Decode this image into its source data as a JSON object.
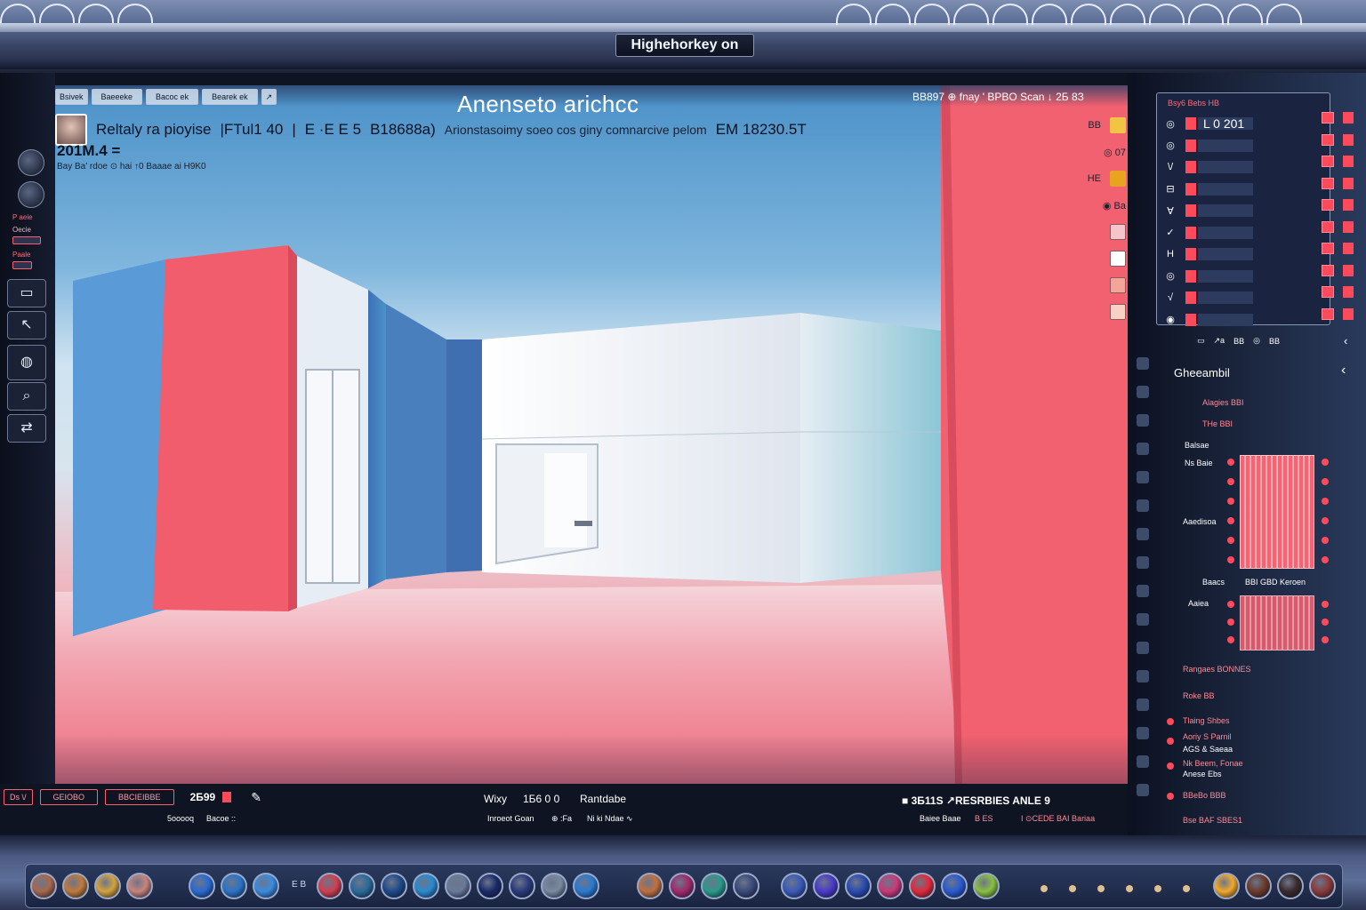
{
  "window": {
    "title": "Highehorkey on"
  },
  "top_tabs": [
    {
      "label": "Bsivek"
    },
    {
      "label": "Baeeeke"
    },
    {
      "label": "Bacoc ek"
    },
    {
      "label": "Bearek ek"
    },
    {
      "label": "↗"
    }
  ],
  "viewport": {
    "title": "Anensetо arichcc",
    "status_right": "BB897 ⊕ fnay ' BPBO Scan ↓ 2Б 8З",
    "info": {
      "project_name": "Reltaly ra pioyise",
      "frame": "|FTul1 40",
      "separator": "|",
      "codes": "E ·E E 5",
      "id": "B18688a)",
      "subtitle": "Arionstasoimy soeo cos giny comnarcive pelom",
      "coord": "EM 18230.5T"
    },
    "counter": "201M.4 =",
    "info_small": "Bay Ba' rdoe ⊙ hai ↑0 Baaae ai H9K0",
    "right_icons": [
      {
        "label": "BB",
        "color": "#f2c443"
      },
      {
        "label": "◎ 07",
        "color": ""
      },
      {
        "label": "HE",
        "color": "#e8a320"
      },
      {
        "label": "◉ Ba",
        "color": ""
      },
      {
        "label": "",
        "color": "#f4c6cb"
      },
      {
        "label": "",
        "color": "#ffffff"
      },
      {
        "label": "",
        "color": "#f3a59a"
      },
      {
        "label": "",
        "color": "#f8d1c4"
      }
    ],
    "bottom_left": {
      "mode_label": "Ds \\/",
      "box_a": "GEIOBO",
      "box_b": "BBCIEIBBE",
      "number": "2Б99",
      "sub_a": "5ooooq",
      "sub_b": "Bacoe ::"
    },
    "bottom_center": {
      "label": "Wixy",
      "value": "1Б6 0 0",
      "name": "Rantdabe",
      "sub_a": "Inroeot Goan",
      "sub_b": "⊕ :Fa",
      "sub_c": "Ni ki Ndae ∿"
    },
    "bottom_right": {
      "status": "■ 3Б11S ↗RESRBIES ANLE 9",
      "sub_a": "Baiee Baae",
      "sub_b": "B ES",
      "sub_c": "I ⊙CEDE BAI Bariaa"
    }
  },
  "left_toolbar": {
    "labels": [
      "P aeie",
      "Oecie",
      "Paale"
    ],
    "tools": [
      {
        "name": "rect-tool",
        "glyph": "▭"
      },
      {
        "name": "select-tool",
        "glyph": "↖"
      },
      {
        "name": "lasso-tool",
        "glyph": "◍"
      },
      {
        "name": "zoom-tool",
        "glyph": "⌕"
      },
      {
        "name": "move-tool",
        "glyph": "⇄"
      }
    ]
  },
  "right_panel": {
    "layer_header": "Bsy6 Bebs HB",
    "layers": [
      {
        "glyph": "◎",
        "value": "L 0 201"
      },
      {
        "glyph": "◎",
        "value": ""
      },
      {
        "glyph": "\\/",
        "value": ""
      },
      {
        "glyph": "⊟",
        "value": ""
      },
      {
        "glyph": "∀",
        "value": ""
      },
      {
        "glyph": "✓",
        "value": ""
      },
      {
        "glyph": "H",
        "value": ""
      },
      {
        "glyph": "◎",
        "value": ""
      },
      {
        "glyph": "√",
        "value": ""
      },
      {
        "glyph": "√",
        "value": ""
      },
      {
        "glyph": "◉",
        "value": ""
      }
    ],
    "layer_toolbar": [
      "▭",
      "↗a",
      "BB",
      "◎",
      "BB"
    ],
    "panel_title": "Gheeambil",
    "props": {
      "a1": "Alagies BBI",
      "a2": "THe BBI",
      "b1": "Balsae",
      "b2": "Ns Baie",
      "c1": "Aaedisoa",
      "d1": "Baacs",
      "d2": "BBI GBD Keroen",
      "e1": "Aaiea",
      "f1": "Rangaes BONNES",
      "f2": "Roke BB",
      "g1": "Tlaing Shbes",
      "g2": "Aoriy S Parnil",
      "g3": "AGS & Saeaa",
      "g4": "Nk Beem, Fonae",
      "g5": "Anese Ebs",
      "h1": "BBeBo BBB",
      "h2": "Bse BAF SBES1"
    }
  },
  "dock": {
    "colors_left": [
      "#a7684c",
      "#c07a3a",
      "#d4a33e",
      "#c9847a"
    ],
    "colors_mid": [
      "#2a6ad0",
      "#2a74c8",
      "#3a8ce0",
      "#d04050",
      "#2a6a9a",
      "#1e4a8a",
      "#2a8ad0",
      "#6a7a9a",
      "#1a2a6a",
      "#2a3a7a",
      "#7a8aa0",
      "#2a7ad0"
    ],
    "mid_text": "E B",
    "colors_right": [
      "#c07040",
      "#a02a6a",
      "#2a9a8a",
      "#3a4a7a",
      "#3a5ab8",
      "#4a3ac8",
      "#2a4ab0",
      "#c83a78",
      "#e02a3a",
      "#2a5ad0",
      "#8ac040"
    ],
    "colors_far": [
      "#f2a82a",
      "#6a3a2a",
      "#3a2a2a",
      "#8a3a3a"
    ],
    "dots": [
      "#e0c090",
      "#e0c090",
      "#e0c090",
      "#e0c090",
      "#e0c090",
      "#e0c090"
    ]
  }
}
